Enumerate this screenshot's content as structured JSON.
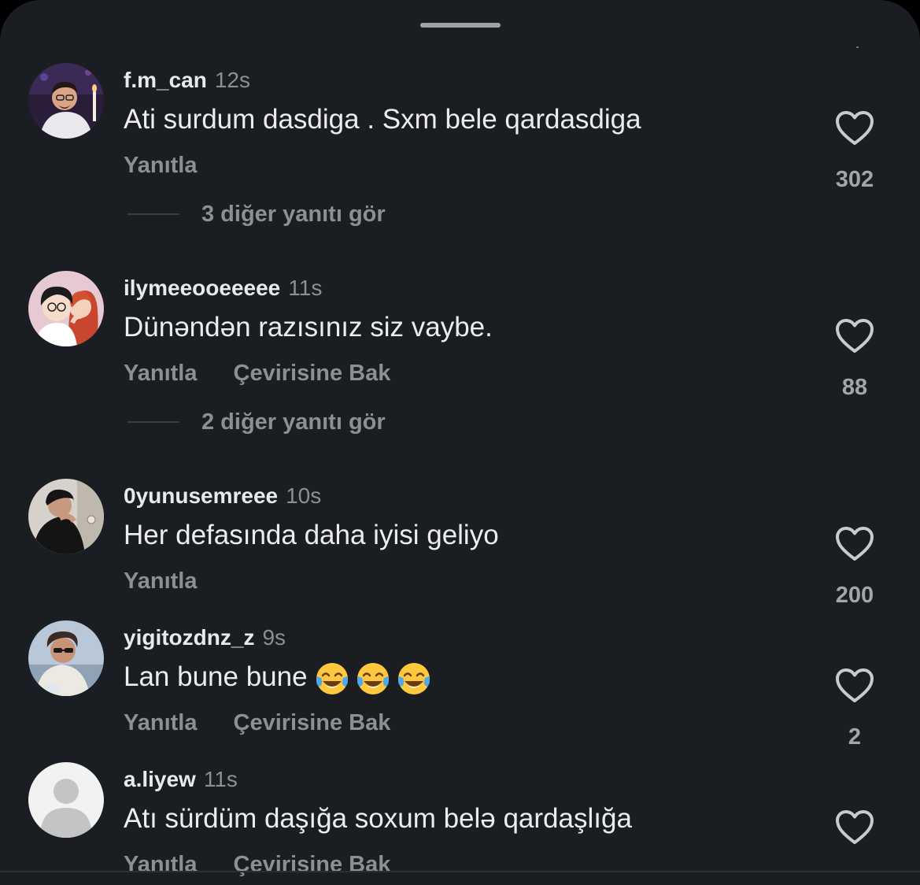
{
  "comments": [
    {
      "username": "f.m_can",
      "time": "12s",
      "text": "Ati surdum dasdiga . Sxm bele qardasdiga",
      "reply_label": "Yanıtla",
      "translate_label": "",
      "more_replies": "3 diğer yanıtı gör",
      "likes": "302",
      "avatar": "photo-man-candle"
    },
    {
      "username": "ilymeeooeeeee",
      "time": "11s",
      "text": "Dünəndən razısınız siz vaybe.",
      "reply_label": "Yanıtla",
      "translate_label": "Çevirisine Bak",
      "more_replies": "2 diğer yanıtı gör",
      "likes": "88",
      "avatar": "cartoon-couple"
    },
    {
      "username": "0yunusemreee",
      "time": "10s",
      "text": "Her defasında daha iyisi geliyo",
      "reply_label": "Yanıtla",
      "translate_label": "",
      "more_replies": "",
      "likes": "200",
      "avatar": "photo-dark-hooded"
    },
    {
      "username": "yigitozdnz_z",
      "time": "9s",
      "text": "Lan bune bune",
      "emojis": [
        "face-with-tears-of-joy",
        "face-with-tears-of-joy",
        "face-with-tears-of-joy"
      ],
      "reply_label": "Yanıtla",
      "translate_label": "Çevirisine Bak",
      "more_replies": "",
      "likes": "2",
      "avatar": "photo-man-sunglasses"
    },
    {
      "username": "a.liyew",
      "time": "11s",
      "text": "Atı sürdüm daşığa soxum belə qardaşlığa",
      "reply_label": "Yanıtla",
      "translate_label": "Çevirisine Bak",
      "more_replies": "",
      "likes": "",
      "avatar": "default-avatar"
    }
  ],
  "colors": {
    "background": "#1a1d21",
    "username": "#e8e9eb",
    "secondary_text": "#8c8f94",
    "like_icon": "#c9cacd"
  }
}
